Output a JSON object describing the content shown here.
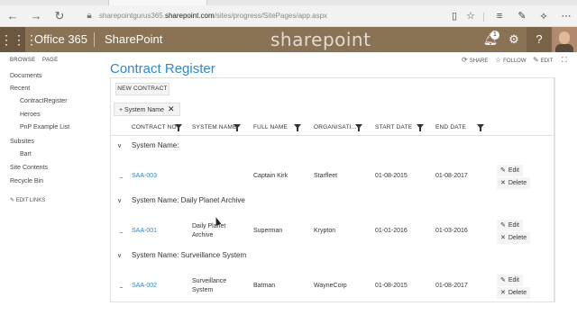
{
  "browser": {
    "url_prefix": "sharepointgurus365.",
    "url_domain": "sharepoint.com",
    "url_path": "/sites/progress/SitePages/app.aspx"
  },
  "suite": {
    "brand": "Office 365",
    "app": "SharePoint",
    "logo_text": "sharepoint",
    "notification_count": "1",
    "help": "?"
  },
  "ribbon": {
    "tabs": [
      "BROWSE",
      "PAGE"
    ],
    "share": "SHARE",
    "follow": "FOLLOW",
    "edit": "EDIT"
  },
  "leftnav": {
    "items": [
      {
        "label": "Documents",
        "sub": false
      },
      {
        "label": "Recent",
        "sub": false
      },
      {
        "label": "ContractRegister",
        "sub": true
      },
      {
        "label": "Heroes",
        "sub": true
      },
      {
        "label": "PnP Example List",
        "sub": true
      },
      {
        "label": "Subsites",
        "sub": false
      },
      {
        "label": "Bart",
        "sub": true
      },
      {
        "label": "Site Contents",
        "sub": false
      },
      {
        "label": "Recycle Bin",
        "sub": false
      }
    ],
    "edit_links": "EDIT LINKS"
  },
  "main": {
    "title": "Contract Register",
    "new_contract": "NEW CONTRACT",
    "group_chip": "System Name",
    "columns": [
      "CONTRACT NO",
      "SYSTEM NAME",
      "FULL NAME",
      "ORGANISATI...",
      "START DATE",
      "END DATE"
    ],
    "edit_label": "Edit",
    "delete_label": "Delete",
    "groups": [
      {
        "header": "System Name:",
        "row": {
          "contract_no": "SAA-003",
          "system_name": "",
          "full_name": "Captain Kirk",
          "organisation": "Starfleet",
          "start_date": "01-08-2015",
          "end_date": "01-08-2017"
        }
      },
      {
        "header": "System Name: Daily Planet Archive",
        "row": {
          "contract_no": "SAA-001",
          "system_name": "Daily Planet Archive",
          "full_name": "Superman",
          "organisation": "Krypton",
          "start_date": "01-01-2016",
          "end_date": "01-03-2016"
        }
      },
      {
        "header": "System Name: Surveillance System",
        "row": {
          "contract_no": "SAA-002",
          "system_name": "Surveillance System",
          "full_name": "Batman",
          "organisation": "WayneCorp",
          "start_date": "01-08-2015",
          "end_date": "01-08-2017"
        }
      }
    ]
  },
  "colors": {
    "suitebar": "#8a7255",
    "accent": "#2b88d8"
  }
}
